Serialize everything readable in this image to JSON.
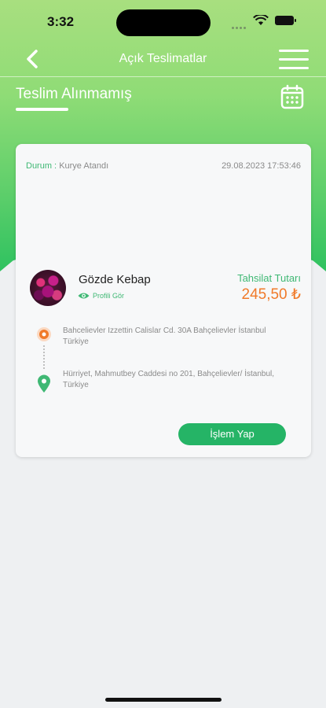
{
  "status_bar": {
    "time": "3:32"
  },
  "nav": {
    "title": "Açık Teslimatlar"
  },
  "tabs": [
    {
      "label": "Teslim Alınmamış",
      "active": true
    }
  ],
  "delivery": {
    "status_label": "Durum :",
    "status_value": "Kurye Atandı",
    "datetime": "29.08.2023 17:53:46",
    "store_name": "Gözde Kebap",
    "profile_link": "Profili Gör",
    "amount_label": "Tahsilat Tutarı",
    "amount": "245,50 ₺",
    "pickup_address": "Bahcelievler Izzettin Calislar Cd. 30A Bahçelievler İstanbul Türkiye",
    "delivery_address": "Hürriyet, Mahmutbey Caddesi no 201, Bahçelievler/ İstanbul, Türkiye",
    "action_label": "İşlem Yap"
  },
  "colors": {
    "brand_green": "#25b466",
    "label_green": "#3fb874",
    "amount_orange": "#f07a2a"
  },
  "icons": [
    "back-chevron-icon",
    "hamburger-menu-icon",
    "calendar-icon",
    "eye-icon",
    "origin-pin-icon",
    "destination-pin-icon"
  ]
}
